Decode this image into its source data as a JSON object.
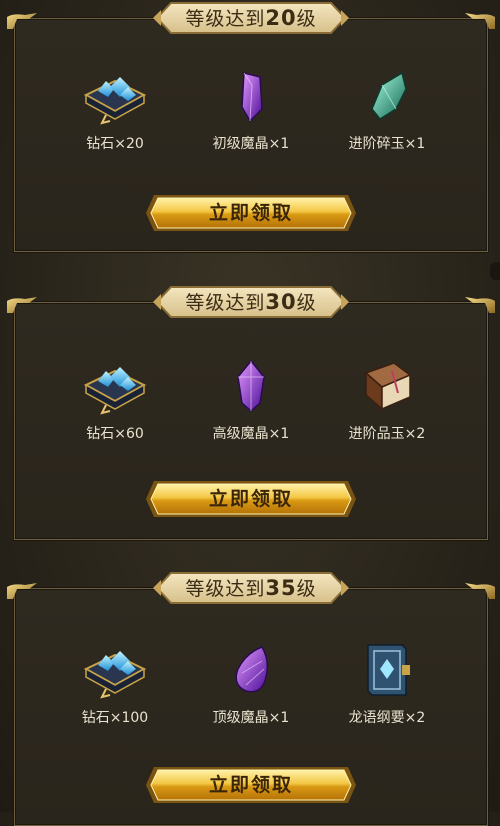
{
  "tiers": [
    {
      "banner_prefix": "等级达到",
      "banner_level": "20",
      "banner_suffix": "级",
      "items": [
        {
          "label": "钻石×20",
          "icon": "diamond-pack-icon"
        },
        {
          "label": "初级魔晶×1",
          "icon": "purple-crystal-icon"
        },
        {
          "label": "进阶碎玉×1",
          "icon": "green-jade-shard-icon"
        }
      ],
      "button_label": "立即领取"
    },
    {
      "banner_prefix": "等级达到",
      "banner_level": "30",
      "banner_suffix": "级",
      "items": [
        {
          "label": "钻石×60",
          "icon": "diamond-pack-icon"
        },
        {
          "label": "高级魔晶×1",
          "icon": "purple-gem-icon"
        },
        {
          "label": "进阶品玉×2",
          "icon": "brown-book-icon"
        }
      ],
      "button_label": "立即领取"
    },
    {
      "banner_prefix": "等级达到",
      "banner_level": "35",
      "banner_suffix": "级",
      "items": [
        {
          "label": "钻石×100",
          "icon": "diamond-pack-icon"
        },
        {
          "label": "顶级魔晶×1",
          "icon": "purple-teardrop-gem-icon"
        },
        {
          "label": "龙语纲要×2",
          "icon": "blue-book-icon"
        }
      ],
      "button_label": "立即领取"
    }
  ]
}
